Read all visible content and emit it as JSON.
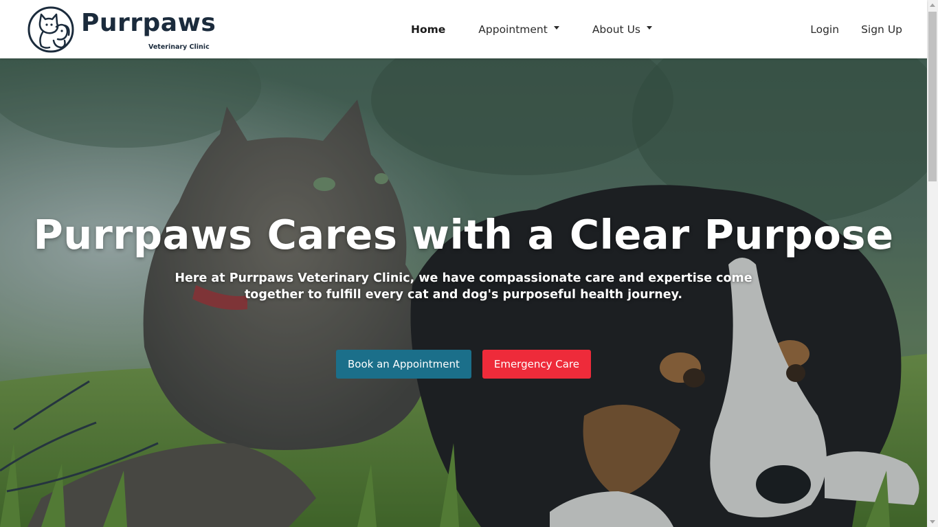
{
  "brand": {
    "name": "Purrpaws",
    "subtitle": "Veterinary Clinic"
  },
  "nav": {
    "home": "Home",
    "appointment": "Appointment",
    "about": "About Us",
    "login": "Login",
    "signup": "Sign Up"
  },
  "hero": {
    "title": "Purrpaws Cares with a Clear Purpose",
    "subtitle": "Here at Purrpaws Veterinary Clinic, we have compassionate care and expertise come together to fulfill every cat and dog's purposeful health journey.",
    "book_button": "Book an Appointment",
    "emergency_button": "Emergency Care"
  },
  "colors": {
    "brand_dark": "#1b2b3c",
    "primary_button": "#1b6f8a",
    "danger_button": "#ee2b3a"
  },
  "icons": {
    "logo": "cat-dog-logo-icon",
    "dropdown": "caret-down-icon"
  }
}
